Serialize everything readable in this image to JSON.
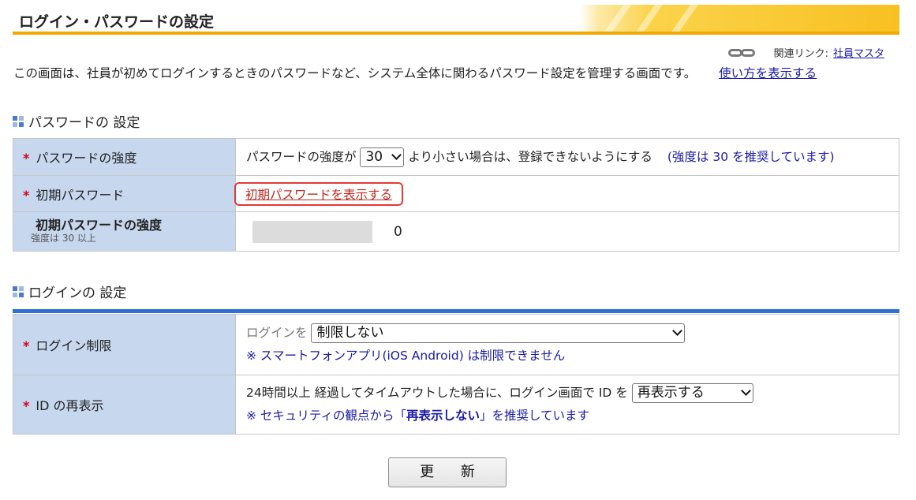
{
  "page": {
    "title": "ログイン・パスワードの設定",
    "related_label": "関連リンク:",
    "related_link": "社員マスタ",
    "description": "この画面は、社員が初めてログインするときのパスワードなど、システム全体に関わるパスワード設定を管理する画面です。",
    "howto_link": "使い方を表示する"
  },
  "password_section": {
    "heading": "パスワードの 設定",
    "strength": {
      "label": "パスワードの強度",
      "prefix": "パスワードの強度が",
      "value": "30",
      "suffix": "より小さい場合は、登録できないようにする",
      "note": "(強度は 30 を推奨しています)"
    },
    "initial_password": {
      "label": "初期パスワード",
      "link": "初期パスワードを表示する"
    },
    "initial_strength": {
      "label": "初期パスワードの強度",
      "sub": "強度は 30 以上",
      "value": "0"
    }
  },
  "login_section": {
    "heading": "ログインの 設定",
    "restriction": {
      "label": "ログイン制限",
      "prefix": "ログインを",
      "value": "制限しない",
      "note": "※ スマートフォンアプリ(iOS Android) は制限できません"
    },
    "id_redisplay": {
      "label": "ID の再表示",
      "prefix": "24時間以上 経過してタイムアウトした場合に、ログイン画面で ID を",
      "value": "再表示する",
      "note_prefix": "※ セキュリティの観点から「",
      "note_bold": "再表示しない",
      "note_suffix": "」を推奨しています"
    }
  },
  "actions": {
    "update": "更 新"
  },
  "icons": {
    "link": "link-chain-icon",
    "section": "section-square-icon",
    "required": "required-asterisk"
  },
  "colors": {
    "accent": "#f1a800",
    "label_bg": "#c6d7ee",
    "link": "#1a1aa6",
    "required": "#d8001c",
    "highlight": "#e53935"
  }
}
